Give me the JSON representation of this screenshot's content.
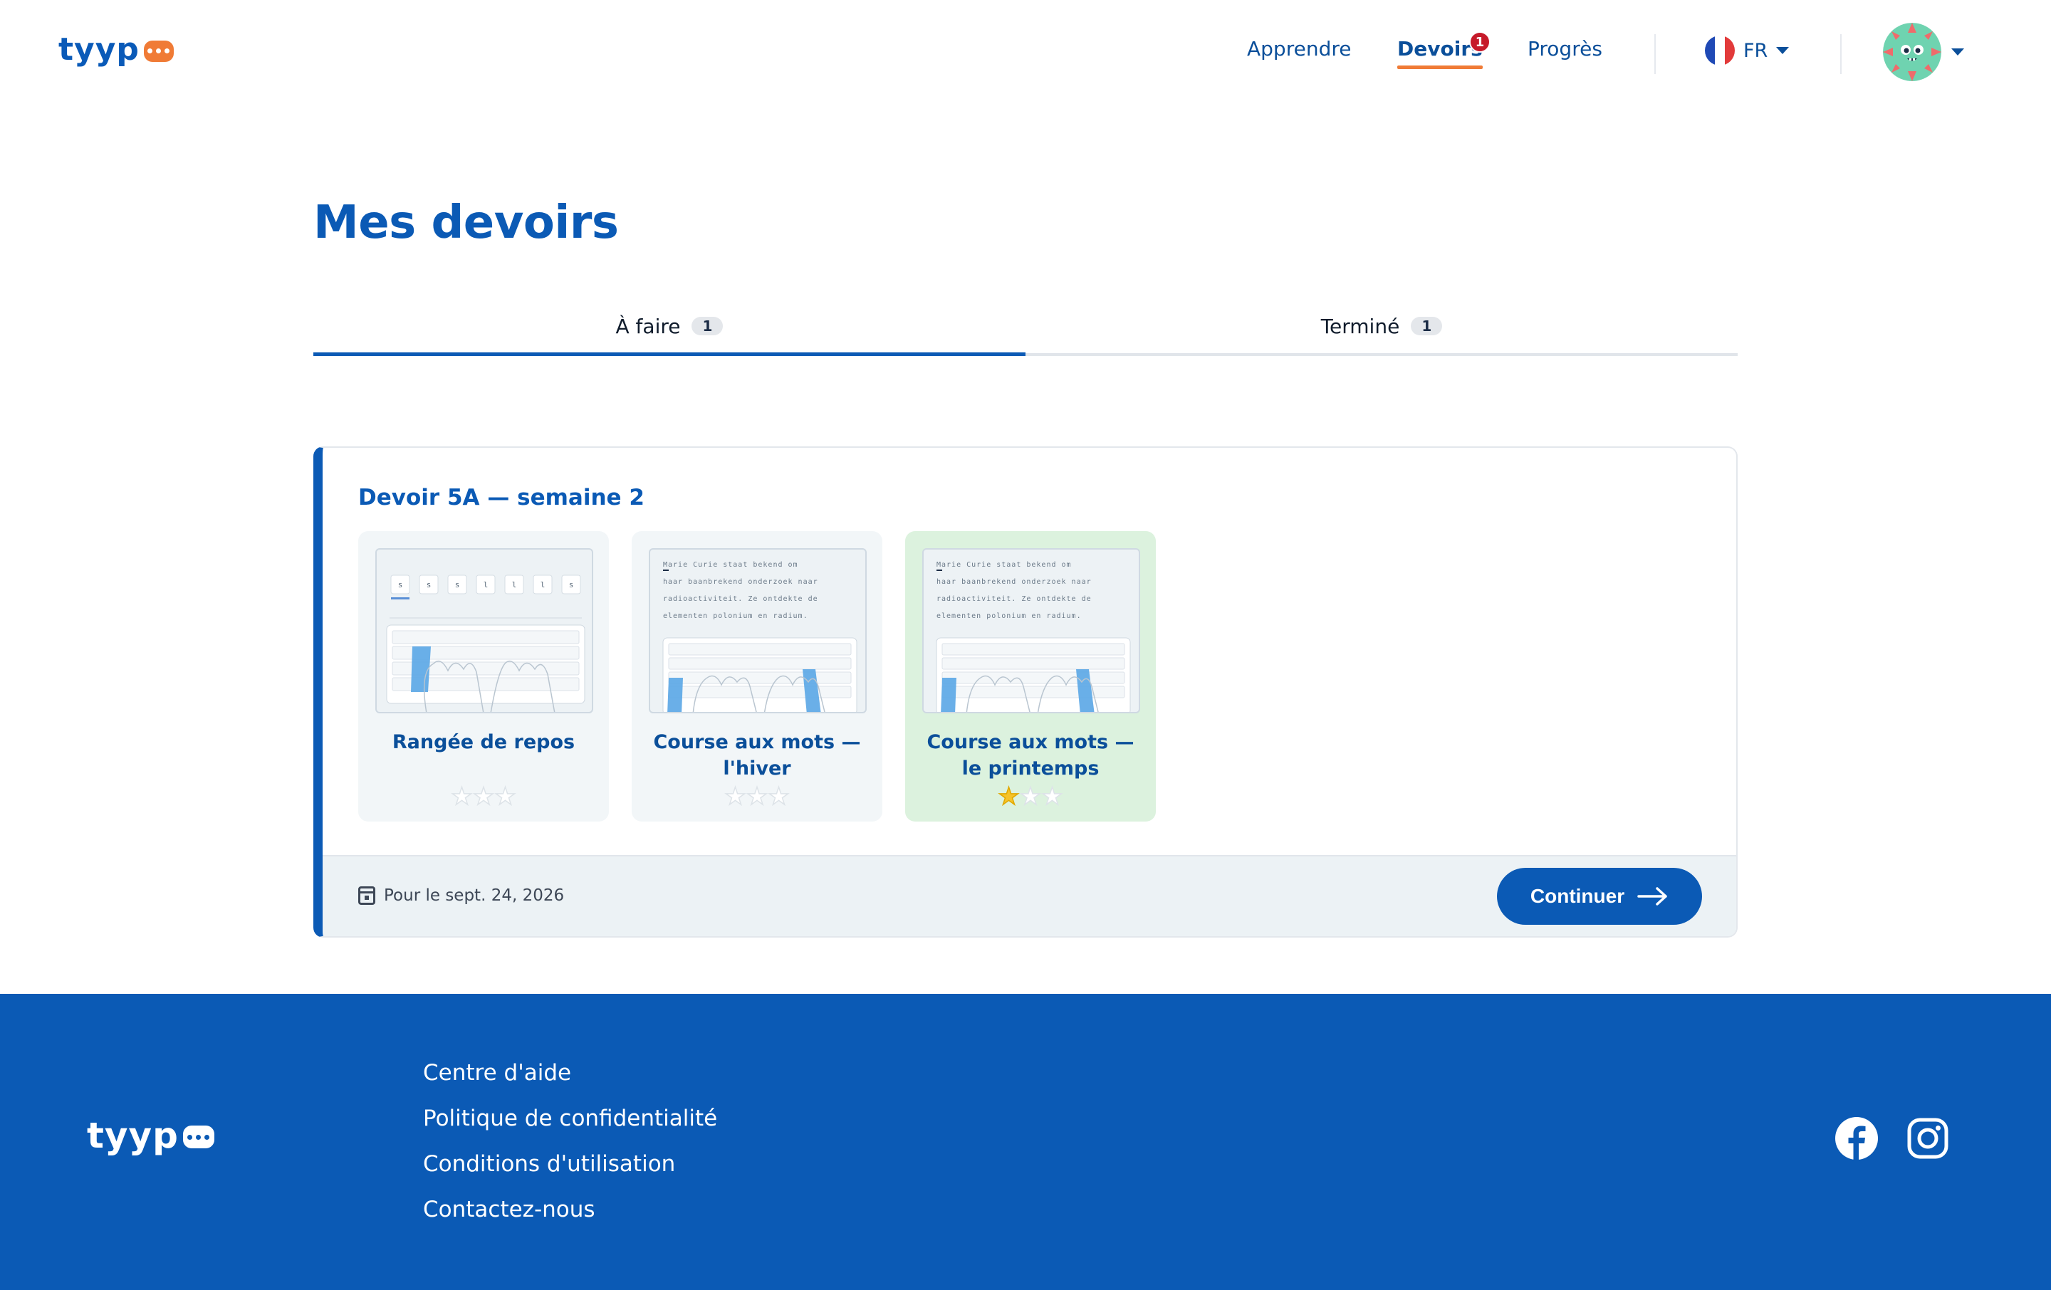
{
  "brand": {
    "name": "tyyp"
  },
  "nav": {
    "learn": "Apprendre",
    "homework": "Devoirs",
    "homework_badge": "1",
    "progress": "Progrès",
    "language": {
      "code": "FR",
      "flag_icon": "france-flag-icon"
    },
    "avatar_icon": "avatar-monster-icon"
  },
  "main": {
    "title": "Mes devoirs",
    "tabs": [
      {
        "label": "À faire",
        "count": "1",
        "active": true
      },
      {
        "label": "Terminé",
        "count": "1",
        "active": false
      }
    ]
  },
  "assignment": {
    "title": "Devoir 5A — semaine 2",
    "lessons": [
      {
        "title": "Rangée de repos",
        "stars": 0,
        "max_stars": 3,
        "completed": false,
        "thumbnail": "keyboard-letters-preview"
      },
      {
        "title": "Course aux mots — l'hiver",
        "stars": 0,
        "max_stars": 3,
        "completed": false,
        "thumbnail": "keyboard-text-preview"
      },
      {
        "title": "Course aux mots — le printemps",
        "stars": 1,
        "max_stars": 3,
        "completed": true,
        "thumbnail": "keyboard-text-preview"
      }
    ],
    "thumbnail_text": [
      "Marie Curie staat bekend om",
      "haar baanbrekend onderzoek naar",
      "radioactiviteit. Ze ontdekte de",
      "elementen polonium en radium."
    ],
    "thumbnail_letters": [
      "s",
      "s",
      "s",
      "l",
      "l",
      "l",
      "s"
    ],
    "due": "Pour le sept. 24, 2026",
    "continue_label": "Continuer"
  },
  "footer": {
    "links": [
      "Centre d'aide",
      "Politique de confidentialité",
      "Conditions d'utilisation",
      "Contactez-nous"
    ],
    "social": [
      "facebook-icon",
      "instagram-icon"
    ]
  },
  "colors": {
    "primary": "#0b5ab5",
    "accent": "#f07b36",
    "completed_bg": "#dcf2de",
    "star": "#f6c32a"
  }
}
